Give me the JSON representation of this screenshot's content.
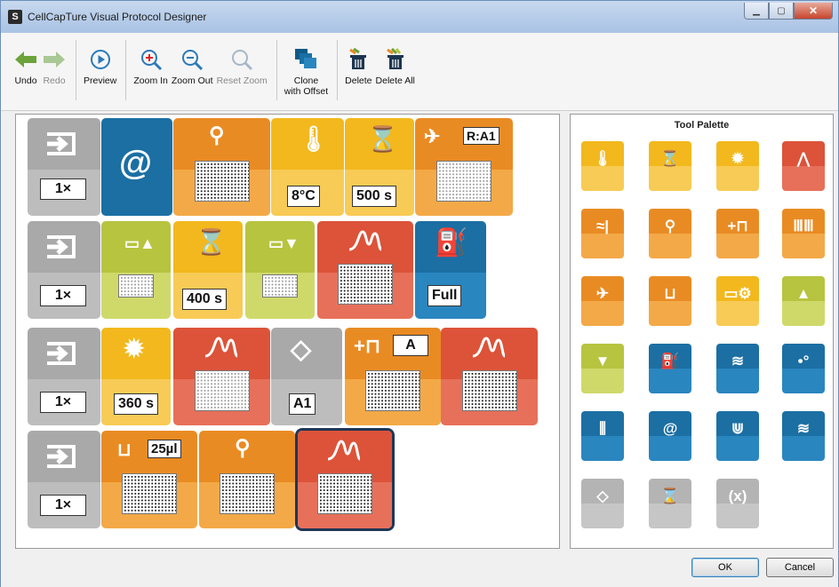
{
  "window": {
    "title": "CellCapTure Visual Protocol Designer",
    "app_icon": "S"
  },
  "toolbar": {
    "undo": "Undo",
    "redo": "Redo",
    "preview": "Preview",
    "zoom_in": "Zoom In",
    "zoom_out": "Zoom Out",
    "reset_zoom": "Reset Zoom",
    "clone_line1": "Clone",
    "clone_line2": "with Offset",
    "delete": "Delete",
    "delete_all": "Delete All"
  },
  "palette": {
    "title": "Tool Palette"
  },
  "protocol": {
    "rows": [
      {
        "repeat": "1×",
        "values": [
          "8°C",
          "500 s",
          "R:A1"
        ]
      },
      {
        "repeat": "1×",
        "values": [
          "400 s",
          "Full"
        ]
      },
      {
        "repeat": "1×",
        "values": [
          "360 s",
          "A1",
          "A"
        ]
      },
      {
        "repeat": "1×",
        "values": [
          "25µl"
        ]
      }
    ]
  },
  "dialog": {
    "ok": "OK",
    "cancel": "Cancel"
  },
  "colors": {
    "gray": "#a9a9a9",
    "gray_dark": "#8f8f8f",
    "blue": "#1b6fa3",
    "blue_dark": "#155a86",
    "orange": "#e98b23",
    "orange_light": "#f3a947",
    "yellow": "#f2b81d",
    "yellow_light": "#f7cb55",
    "red": "#dc5339",
    "red_light": "#e7705a",
    "green": "#b7c43f",
    "green_light": "#cfd96a"
  }
}
